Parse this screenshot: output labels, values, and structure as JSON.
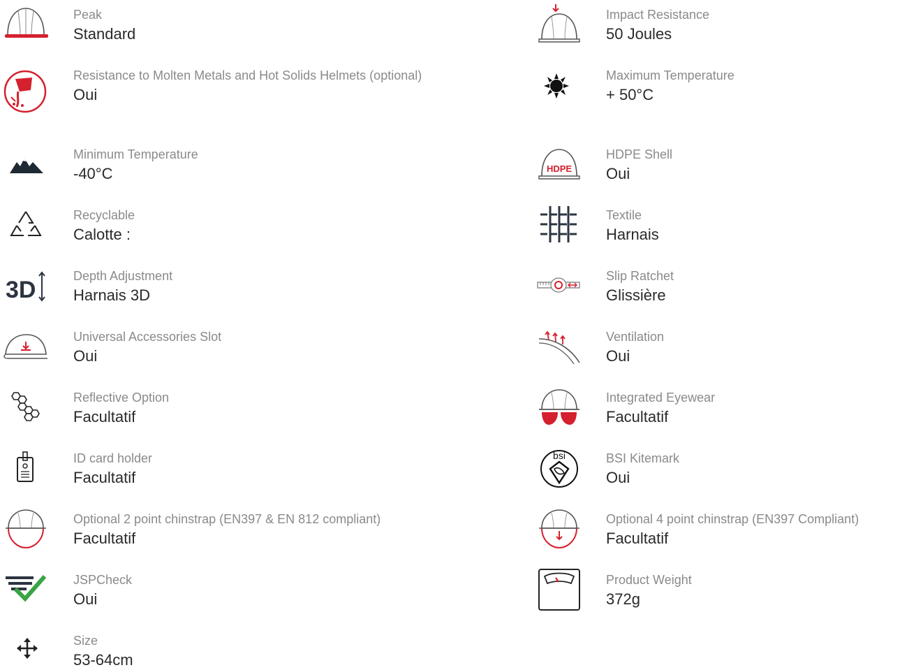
{
  "colors": {
    "label": "#8a8a8a",
    "value": "#2a2a2a",
    "accent": "#d5202e",
    "check": "#3aa345",
    "icon_dark": "#2b3440"
  },
  "features_left": [
    {
      "icon": "peak-helmet-icon",
      "label": "Peak",
      "value": "Standard"
    },
    {
      "icon": "molten-metal-icon",
      "label": "Resistance to Molten Metals and Hot Solids Helmets (optional)",
      "value": "Oui"
    },
    {
      "icon": "mountains-icon",
      "label": "Minimum Temperature",
      "value": "-40°C"
    },
    {
      "icon": "recycle-icon",
      "label": "Recyclable",
      "value": "Calotte :"
    },
    {
      "icon": "3d-depth-icon",
      "label": "Depth Adjustment",
      "value": "Harnais 3D"
    },
    {
      "icon": "accessory-slot-icon",
      "label": "Universal Accessories Slot",
      "value": "Oui"
    },
    {
      "icon": "honeycomb-icon",
      "label": "Reflective Option",
      "value": "Facultatif"
    },
    {
      "icon": "id-card-icon",
      "label": "ID card holder",
      "value": "Facultatif"
    },
    {
      "icon": "chinstrap-2pt-icon",
      "label": "Optional 2 point chinstrap (EN397 & EN 812 compliant)",
      "value": "Facultatif"
    },
    {
      "icon": "jspcheck-icon",
      "label": "JSPCheck",
      "value": "Oui"
    },
    {
      "icon": "move-arrows-icon",
      "label": "Size",
      "value": "53-64cm"
    }
  ],
  "features_right": [
    {
      "icon": "impact-helmet-icon",
      "label": "Impact Resistance",
      "value": "50 Joules"
    },
    {
      "icon": "sun-icon",
      "label": "Maximum Temperature",
      "value": "+ 50°C"
    },
    {
      "icon": "hdpe-helmet-icon",
      "label": "HDPE Shell",
      "value": "Oui",
      "badge": "HDPE"
    },
    {
      "icon": "textile-icon",
      "label": "Textile",
      "value": "Harnais"
    },
    {
      "icon": "slip-ratchet-icon",
      "label": "Slip Ratchet",
      "value": "Glissière"
    },
    {
      "icon": "ventilation-icon",
      "label": "Ventilation",
      "value": "Oui"
    },
    {
      "icon": "eyewear-helmet-icon",
      "label": "Integrated Eyewear",
      "value": "Facultatif"
    },
    {
      "icon": "bsi-kitemark-icon",
      "label": "BSI Kitemark",
      "value": "Oui",
      "badge": "bsi"
    },
    {
      "icon": "chinstrap-4pt-icon",
      "label": "Optional 4 point chinstrap (EN397 Compliant)",
      "value": "Facultatif"
    },
    {
      "icon": "weight-scale-icon",
      "label": "Product Weight",
      "value": "372g"
    }
  ]
}
